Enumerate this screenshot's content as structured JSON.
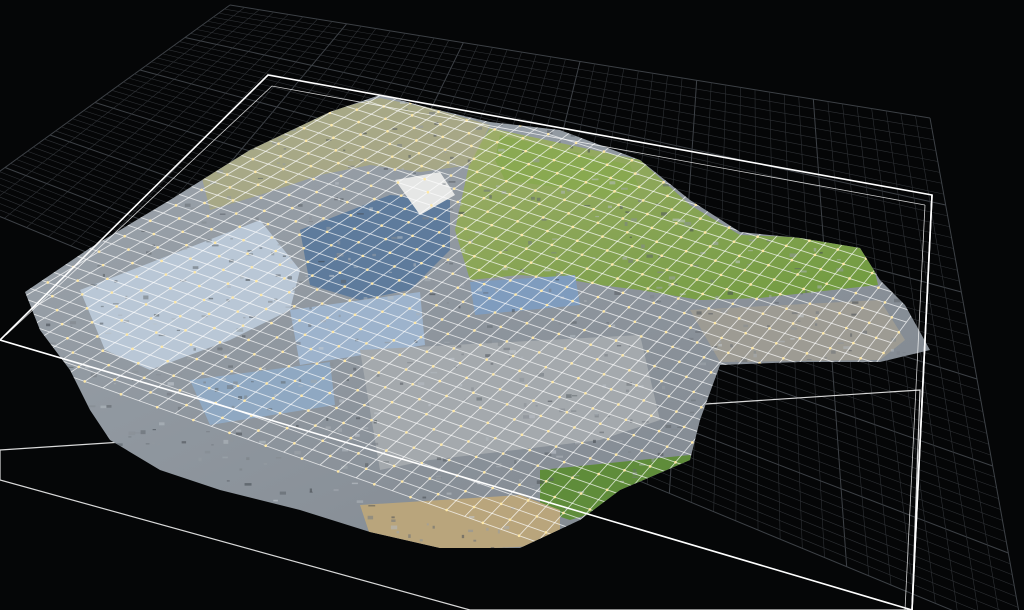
{
  "viewer": {
    "background_color": "#050607",
    "ground_grid_color": "#2e3135",
    "ground_grid_major_color": "#3d4146",
    "bounding_box_color": "#ffffff",
    "flight_grid_color": "#ffffff",
    "flight_point_color": "#ffe9a8",
    "icon": "3d-point-cloud-view"
  }
}
